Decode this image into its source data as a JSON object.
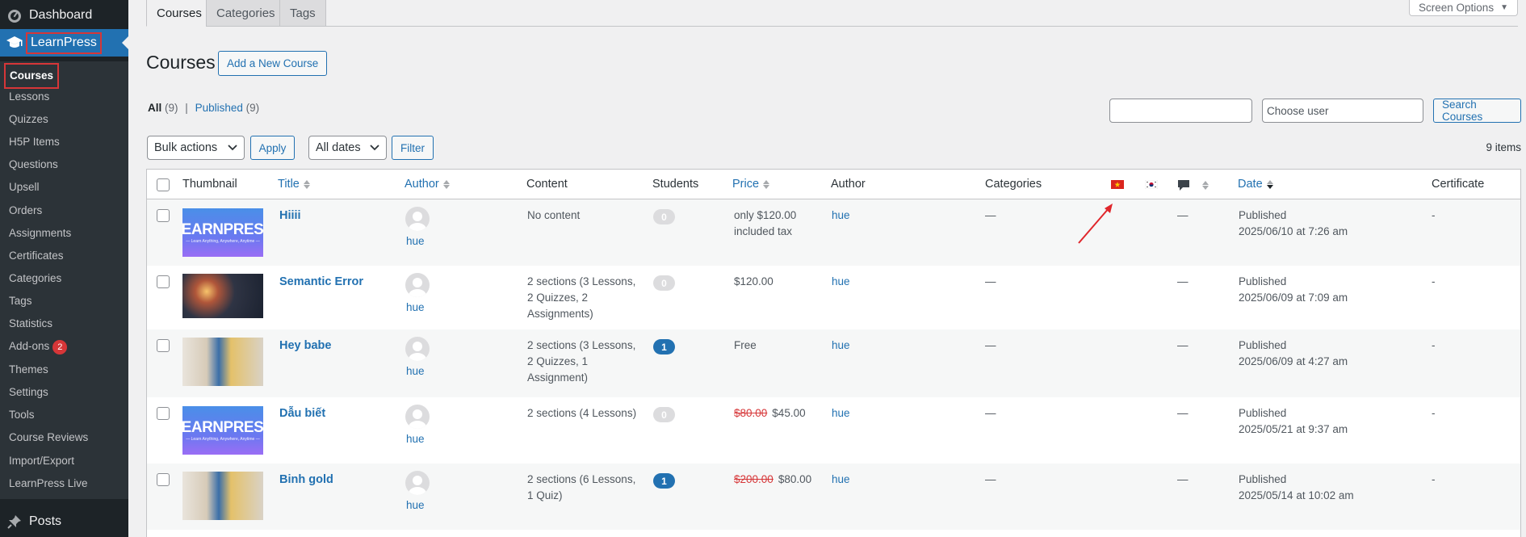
{
  "sidebar": {
    "dashboard": "Dashboard",
    "learnpress": "LearnPress",
    "items": [
      {
        "label": "Courses"
      },
      {
        "label": "Lessons"
      },
      {
        "label": "Quizzes"
      },
      {
        "label": "H5P Items"
      },
      {
        "label": "Questions"
      },
      {
        "label": "Upsell"
      },
      {
        "label": "Orders"
      },
      {
        "label": "Assignments"
      },
      {
        "label": "Certificates"
      },
      {
        "label": "Categories"
      },
      {
        "label": "Tags"
      },
      {
        "label": "Statistics"
      },
      {
        "label": "Add-ons",
        "badge": "2"
      },
      {
        "label": "Themes"
      },
      {
        "label": "Settings"
      },
      {
        "label": "Tools"
      },
      {
        "label": "Course Reviews"
      },
      {
        "label": "Import/Export"
      },
      {
        "label": "LearnPress Live"
      }
    ],
    "posts": "Posts"
  },
  "tabs": [
    "Courses",
    "Categories",
    "Tags"
  ],
  "screen_options": "Screen Options",
  "page_title": "Courses",
  "add_new": "Add a New Course",
  "views": {
    "all_label": "All",
    "all_count": "(9)",
    "published_label": "Published",
    "published_count": "(9)",
    "separator": "|"
  },
  "search": {
    "input_value": "",
    "user_placeholder": "Choose user",
    "button": "Search Courses"
  },
  "bulk_actions": "Bulk actions",
  "apply": "Apply",
  "dates": "All dates",
  "filter": "Filter",
  "items_count": "9 items",
  "columns": {
    "thumbnail": "Thumbnail",
    "title": "Title",
    "author1": "Author",
    "content": "Content",
    "students": "Students",
    "price": "Price",
    "author2": "Author",
    "categories": "Categories",
    "date": "Date",
    "certificate": "Certificate"
  },
  "thumbnail_text": {
    "brand": "LEARNPRESS",
    "tagline": "— Learn Anything, Anywhere, Anytime —"
  },
  "rows": [
    {
      "title": "Hiiii",
      "author": "hue",
      "content": "No content",
      "students": "0",
      "price_old": "",
      "price": "only $120.00 included tax",
      "author2": "hue",
      "categories": "—",
      "comments": "—",
      "status": "Published",
      "date": "2025/06/10 at 7:26 am",
      "certificate": "-"
    },
    {
      "title": "Semantic Error",
      "author": "hue",
      "content": "2 sections (3 Lessons, 2 Quizzes, 2 Assignments)",
      "students": "0",
      "price_old": "",
      "price": "$120.00",
      "author2": "hue",
      "categories": "—",
      "comments": "—",
      "status": "Published",
      "date": "2025/06/09 at 7:09 am",
      "certificate": "-"
    },
    {
      "title": "Hey babe",
      "author": "hue",
      "content": "2 sections (3 Lessons, 2 Quizzes, 1 Assignment)",
      "students": "1",
      "price_old": "",
      "price": "Free",
      "author2": "hue",
      "categories": "—",
      "comments": "—",
      "status": "Published",
      "date": "2025/06/09 at 4:27 am",
      "certificate": "-"
    },
    {
      "title": "Dẫu biết",
      "author": "hue",
      "content": "2 sections (4 Lessons)",
      "students": "0",
      "price_old": "$80.00",
      "price": "$45.00",
      "author2": "hue",
      "categories": "—",
      "comments": "—",
      "status": "Published",
      "date": "2025/05/21 at 9:37 am",
      "certificate": "-"
    },
    {
      "title": "Binh gold",
      "author": "hue",
      "content": "2 sections (6 Lessons, 1 Quiz)",
      "students": "1",
      "price_old": "$200.00",
      "price": "$80.00",
      "author2": "hue",
      "categories": "—",
      "comments": "—",
      "status": "Published",
      "date": "2025/05/14 at 10:02 am",
      "certificate": "-"
    }
  ],
  "colors": {
    "accent": "#2271b1",
    "sidebar": "#1d2327",
    "highlight": "#d63638"
  }
}
